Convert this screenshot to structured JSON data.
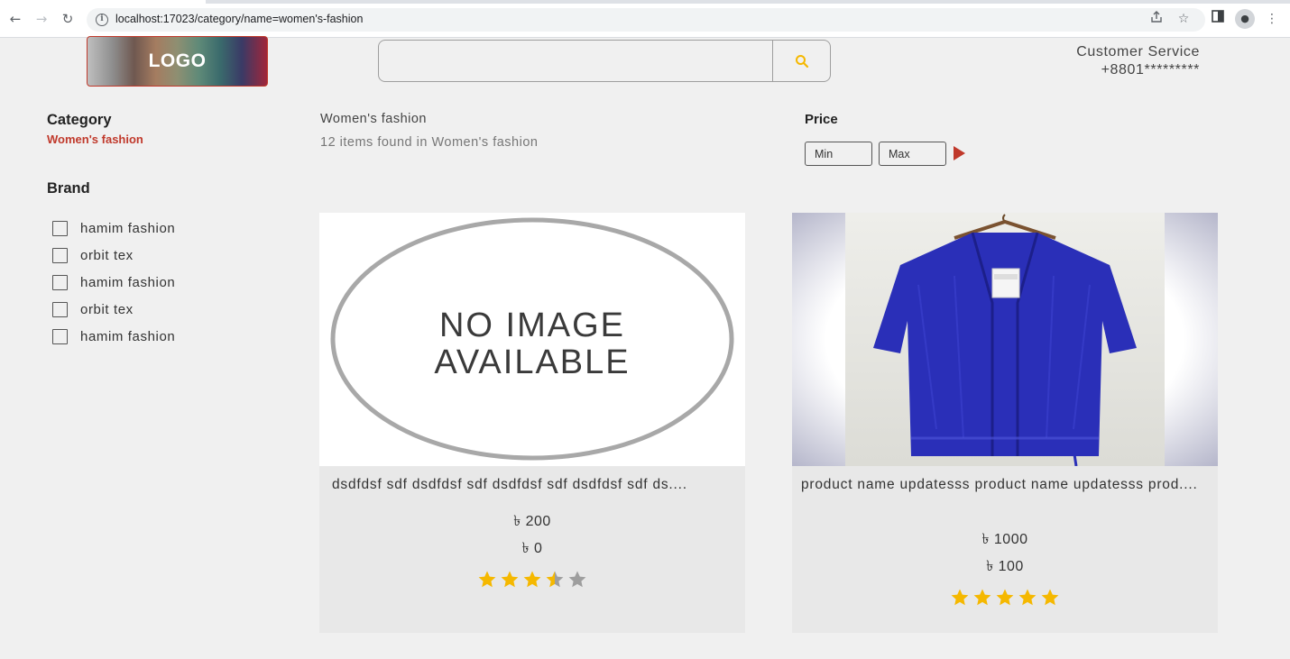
{
  "browser": {
    "url": "localhost:17023/category/name=women's-fashion",
    "back_icon": "back-arrow-icon",
    "forward_icon": "forward-arrow-icon",
    "reload_icon": "reload-icon"
  },
  "header": {
    "logo": "LOGO",
    "search": {
      "placeholder": "",
      "value": ""
    },
    "customer_service": {
      "label": "Customer Service",
      "phone": "+8801*********"
    }
  },
  "sidebar": {
    "category_heading": "Category",
    "category_value": "Women's fashion",
    "brand_heading": "Brand",
    "brands": [
      {
        "label": "hamim fashion",
        "checked": false
      },
      {
        "label": "orbit tex",
        "checked": false
      },
      {
        "label": "hamim fashion",
        "checked": false
      },
      {
        "label": "orbit tex",
        "checked": false
      },
      {
        "label": "hamim fashion",
        "checked": false
      }
    ]
  },
  "main": {
    "title": "Women's fashion",
    "items_found": "12 items found in Women's fashion",
    "price_filter": {
      "heading": "Price",
      "min_placeholder": "Min",
      "max_placeholder": "Max"
    }
  },
  "products": [
    {
      "name": "dsdfdsf sdf dsdfdsf sdf dsdfdsf sdf dsdfdsf sdf ds....",
      "price": "৳ 200",
      "discount_price": "৳ 0",
      "rating": 3.5,
      "image": "no-image-placeholder",
      "image_text_1": "NO IMAGE",
      "image_text_2": "AVAILABLE"
    },
    {
      "name": "product name updatesss product name updatesss prod....",
      "price": "৳ 1000",
      "discount_price": "৳ 100",
      "rating": 5,
      "image": "blue-knit-cardigan-photo"
    }
  ],
  "colors": {
    "accent": "#c0392b",
    "star": "#f5b800",
    "star_empty": "#9e9e9e"
  }
}
